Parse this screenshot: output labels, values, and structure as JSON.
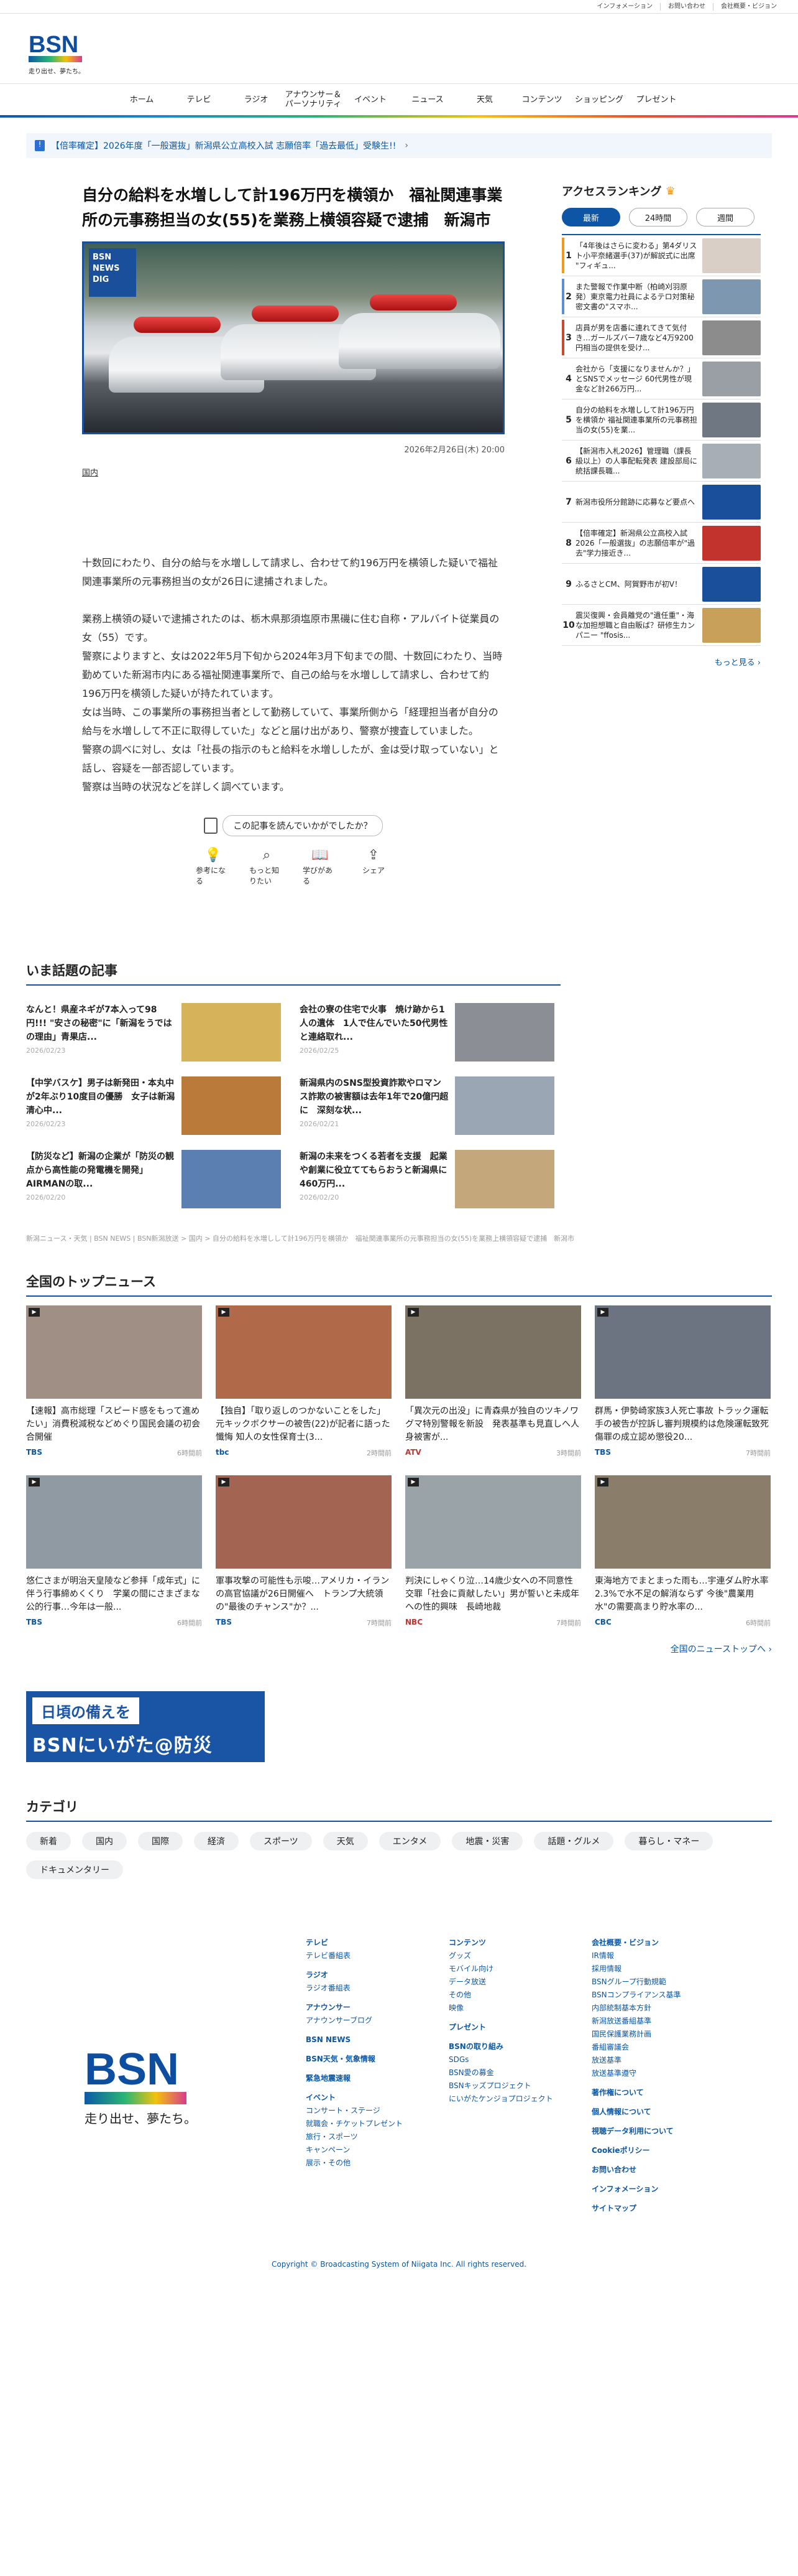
{
  "topbar": [
    "インフォメーション",
    "お問い合わせ",
    "会社概要・ビジョン"
  ],
  "logo": {
    "brand": "BSN",
    "tagline": "走り出せ、夢たち。"
  },
  "gnav": [
    "ホーム",
    "テレビ",
    "ラジオ",
    "アナウンサー＆\nパーソナリティ",
    "イベント",
    "ニュース",
    "天気",
    "コンテンツ",
    "ショッピング",
    "プレゼント"
  ],
  "notice": {
    "icon": "!",
    "text": "【倍率確定】2026年度「一般選抜」新潟県公立高校入試 志願倍率「過去最低」受験生!!",
    "arrow": "›"
  },
  "article": {
    "title": "自分の給料を水増しして計196万円を横領か　福祉関連事業所の元事務担当の女(55)を業務上横領容疑で逮捕　新潟市",
    "badge": "BSN NEWS DIG",
    "date": "2026年2月26日(木) 20:00",
    "category": "国内",
    "lead": "十数回にわたり、自分の給与を水増しして請求し、合わせて約196万円を横領した疑いで福祉関連事業所の元事務担当の女が26日に逮捕されました。",
    "paras": [
      "業務上横領の疑いで逮捕されたのは、栃木県那須塩原市黒磯に住む自称・アルバイト従業員の女（55）です。",
      "警察によりますと、女は2022年5月下旬から2024年3月下旬までの間、十数回にわたり、当時勤めていた新潟市内にある福祉関連事業所で、自己の給与を水増しして請求し、合わせて約196万円を横領した疑いが持たれています。",
      "女は当時、この事業所の事務担当者として勤務していて、事業所側から「経理担当者が自分の給与を水増しして不正に取得していた」などと届け出があり、警察が捜査していました。",
      "警察の調べに対し、女は「社長の指示のもと給料を水増ししたが、金は受け取っていない」と話し、容疑を一部否認しています。",
      "警察は当時の状況などを詳しく調べています。"
    ],
    "feedback_q": "この記事を読んでいかがでしたか？",
    "feedback": [
      "参考になる",
      "もっと知りたい",
      "学びがある",
      "シェア"
    ]
  },
  "ranking": {
    "title": "アクセスランキング",
    "tabs": [
      "最新",
      "24時間",
      "週間"
    ],
    "items": [
      {
        "n": "1",
        "t": "「4年後はさらに変わる」第4ダリスト小平奈緒選手(37)が解説式に出席 \"フィギュ...",
        "c": "#f39a1d",
        "img": "#d9cfc6"
      },
      {
        "n": "2",
        "t": "また警報で作業中断（柏崎刈羽原発）東京電力社員によるテロ対策秘密文書の\"スマホ...",
        "c": "#5a8fd6",
        "img": "#7d97b0"
      },
      {
        "n": "3",
        "t": "店員が男を店番に連れてきて気付き…ガールズバー7歳など4万9200円相当の提供を受け...",
        "c": "#c94b2f",
        "img": "#8c8c8c"
      },
      {
        "n": "4",
        "t": "会社から「支援になりませんか？」とSNSでメッセージ 60代男性が現金など計266万円...",
        "c": "#222",
        "img": "#9a9fa6"
      },
      {
        "n": "5",
        "t": "自分の給料を水増しして計196万円を横領か 福祉関連事業所の元事務担当の女(55)を業...",
        "c": "#222",
        "img": "#6f7882"
      },
      {
        "n": "6",
        "t": "【新潟市入札2026】管理職（課長級以上）の人事配転発表 建設部局に統括課長職...",
        "c": "#222",
        "img": "#a8aeb5"
      },
      {
        "n": "7",
        "t": "新潟市役所分館跡に応募など要点へ",
        "c": "#222",
        "img": "#1a4f9c"
      },
      {
        "n": "8",
        "t": "【倍率確定】新潟県公立高校入試2026「一般選抜」の志願倍率が\"過去\"学力接近き...",
        "c": "#222",
        "img": "#c2332e"
      },
      {
        "n": "9",
        "t": "ふるさとCM、阿賀野市が初V！",
        "c": "#222",
        "img": "#1a4f9c"
      },
      {
        "n": "10",
        "t": "震災復興・会員離党の\"遺任重\"・海な加担想職と自由販ば？研修生カンパニー \"ffosis...",
        "c": "#222",
        "img": "#c9a05a"
      }
    ],
    "more": "もっと見る ›"
  },
  "hot": {
    "title": "いま話題の記事",
    "items": [
      {
        "t": "なんと！県産ネギが7本入って98円!!! \"安さの秘密\"に「新潟をうではの理由」青果店...",
        "d": "2026/02/23",
        "img": "#d6b35a"
      },
      {
        "t": "会社の寮の住宅で火事　焼け跡から1人の遺体　1人で住んでいた50代男性と連絡取れ...",
        "d": "2026/02/25",
        "img": "#8b8f95"
      },
      {
        "t": "【中学バスケ】男子は新発田・本丸中が2年ぶり10度目の優勝　女子は新潟清心中...",
        "d": "2026/02/23",
        "img": "#b97a3a"
      },
      {
        "t": "新潟県内のSNS型投資詐欺やロマンス詐欺の被害額は去年1年で20億円超に　深刻な状...",
        "d": "2026/02/21",
        "img": "#9aa6b3"
      },
      {
        "t": "【防災など】新潟の企業が「防災の観点から高性能の発電機を開発」AIRMANの取...",
        "d": "2026/02/20",
        "img": "#5b7fb0"
      },
      {
        "t": "新潟の未来をつくる若者を支援　起業や創業に役立ててもらおうと新潟県に460万円...",
        "d": "2026/02/20",
        "img": "#c4a77b"
      }
    ]
  },
  "breadcrumb": "新潟ニュース・天気 | BSN NEWS | BSN新潟放送 > 国内 > 自分の給料を水増しして計196万円を横領か　福祉関連事業所の元事務担当の女(55)を業務上横領容疑で逮捕　新潟市",
  "topnews": {
    "title": "全国のトップニュース",
    "items": [
      {
        "t": "【速報】高市総理「スピード感をもって進めたい」消費税減税などめぐり国民会議の初会合開催",
        "src": "TBS",
        "ago": "6時間前",
        "c": "#0c56a3",
        "img": "#9f8f84"
      },
      {
        "t": "【独自】「取り返しのつかないことをした」元キックボクサーの被告(22)が記者に語った懺悔 知人の女性保育士(3...",
        "src": "tbc",
        "ago": "2時間前",
        "c": "#0c56a3",
        "img": "#b06a4a"
      },
      {
        "t": "「異次元の出没」に青森県が独自のツキノワグマ特別警報を新設　発表基準も見直しへ人身被害が...",
        "src": "ATV",
        "ago": "3時間前",
        "c": "#c2332e",
        "img": "#7c7264"
      },
      {
        "t": "群馬・伊勢崎家族3人死亡事故 トラック運転手の被告が控訴し審判規模約は危険運転致死傷罪の成立認め懲役20...",
        "src": "TBS",
        "ago": "7時間前",
        "c": "#0c56a3",
        "img": "#6b7480"
      },
      {
        "t": "悠仁さまが明治天皇陵など参拝「成年式」に伴う行事締めくくり　学業の間にさまざまな公的行事…今年は一般...",
        "src": "TBS",
        "ago": "6時間前",
        "c": "#0c56a3",
        "img": "#8f9aa3"
      },
      {
        "t": "軍事攻撃の可能性も示唆…アメリカ・イランの高官協議が26日開催へ　トランプ大統領の\"最後のチャンス\"か？...",
        "src": "TBS",
        "ago": "7時間前",
        "c": "#0c56a3",
        "img": "#a36452"
      },
      {
        "t": "判決にしゃくり泣…14歳少女への不同意性交罪「社会に貢献したい」男が誓いと未成年への性的興味　長崎地裁",
        "src": "NBC",
        "ago": "7時間前",
        "c": "#c2332e",
        "img": "#9aa3a8"
      },
      {
        "t": "東海地方でまとまった雨も…宇連ダム貯水率2.3%で水不足の解消ならず 今後\"農業用水\"の需要高まり貯水率の...",
        "src": "CBC",
        "ago": "6時間前",
        "c": "#0c56a3",
        "img": "#8a7d6a"
      }
    ],
    "all": "全国のニューストップへ ›"
  },
  "bousai": {
    "l1": "日頃の備えを",
    "l2": "BSNにいがた@防災"
  },
  "categories": {
    "title": "カテゴリ",
    "items": [
      "新着",
      "国内",
      "国際",
      "経済",
      "スポーツ",
      "天気",
      "エンタメ",
      "地震・災害",
      "話題・グルメ",
      "暮らし・マネー",
      "ドキュメンタリー"
    ]
  },
  "footer": {
    "col1": [
      {
        "h": "テレビ",
        "s": [
          "テレビ番組表"
        ]
      },
      {
        "h": "ラジオ",
        "s": [
          "ラジオ番組表"
        ]
      },
      {
        "h": "アナウンサー",
        "s": [
          "アナウンサーブログ"
        ]
      },
      {
        "h": "BSN NEWS",
        "s": []
      },
      {
        "h": "BSN天気・気象情報",
        "s": []
      },
      {
        "h": "緊急地震速報",
        "s": []
      },
      {
        "h": "イベント",
        "s": [
          "コンサート・ステージ",
          "就職会・チケットプレゼント",
          "旅行・スポーツ",
          "キャンペーン",
          "展示・その他"
        ]
      }
    ],
    "col2": [
      {
        "h": "コンテンツ",
        "s": [
          "グッズ",
          "モバイル向け",
          "データ放送",
          "その他",
          "映像"
        ]
      },
      {
        "h": "プレゼント",
        "s": []
      },
      {
        "h": "BSNの取り組み",
        "s": [
          "SDGs",
          "BSN愛の募金",
          "BSNキッズプロジェクト",
          "にいがたケンジョプロジェクト"
        ]
      }
    ],
    "col3": [
      {
        "h": "会社概要・ビジョン",
        "s": [
          "IR情報",
          "採用情報",
          "BSNグループ行動規範",
          "BSNコンプライアンス基準",
          "内部統制基本方針",
          "新潟放送番組基準",
          "国民保護業務計画",
          "番組審議会",
          "放送基準",
          "放送基準遵守"
        ]
      },
      {
        "h": "著作権について",
        "s": []
      },
      {
        "h": "個人情報について",
        "s": []
      },
      {
        "h": "視聴データ利用について",
        "s": []
      },
      {
        "h": "Cookieポリシー",
        "s": []
      },
      {
        "h": "お問い合わせ",
        "s": []
      },
      {
        "h": "インフォメーション",
        "s": []
      },
      {
        "h": "サイトマップ",
        "s": []
      }
    ],
    "copyright": "Copyright © Broadcasting System of Niigata Inc. All rights reserved."
  }
}
